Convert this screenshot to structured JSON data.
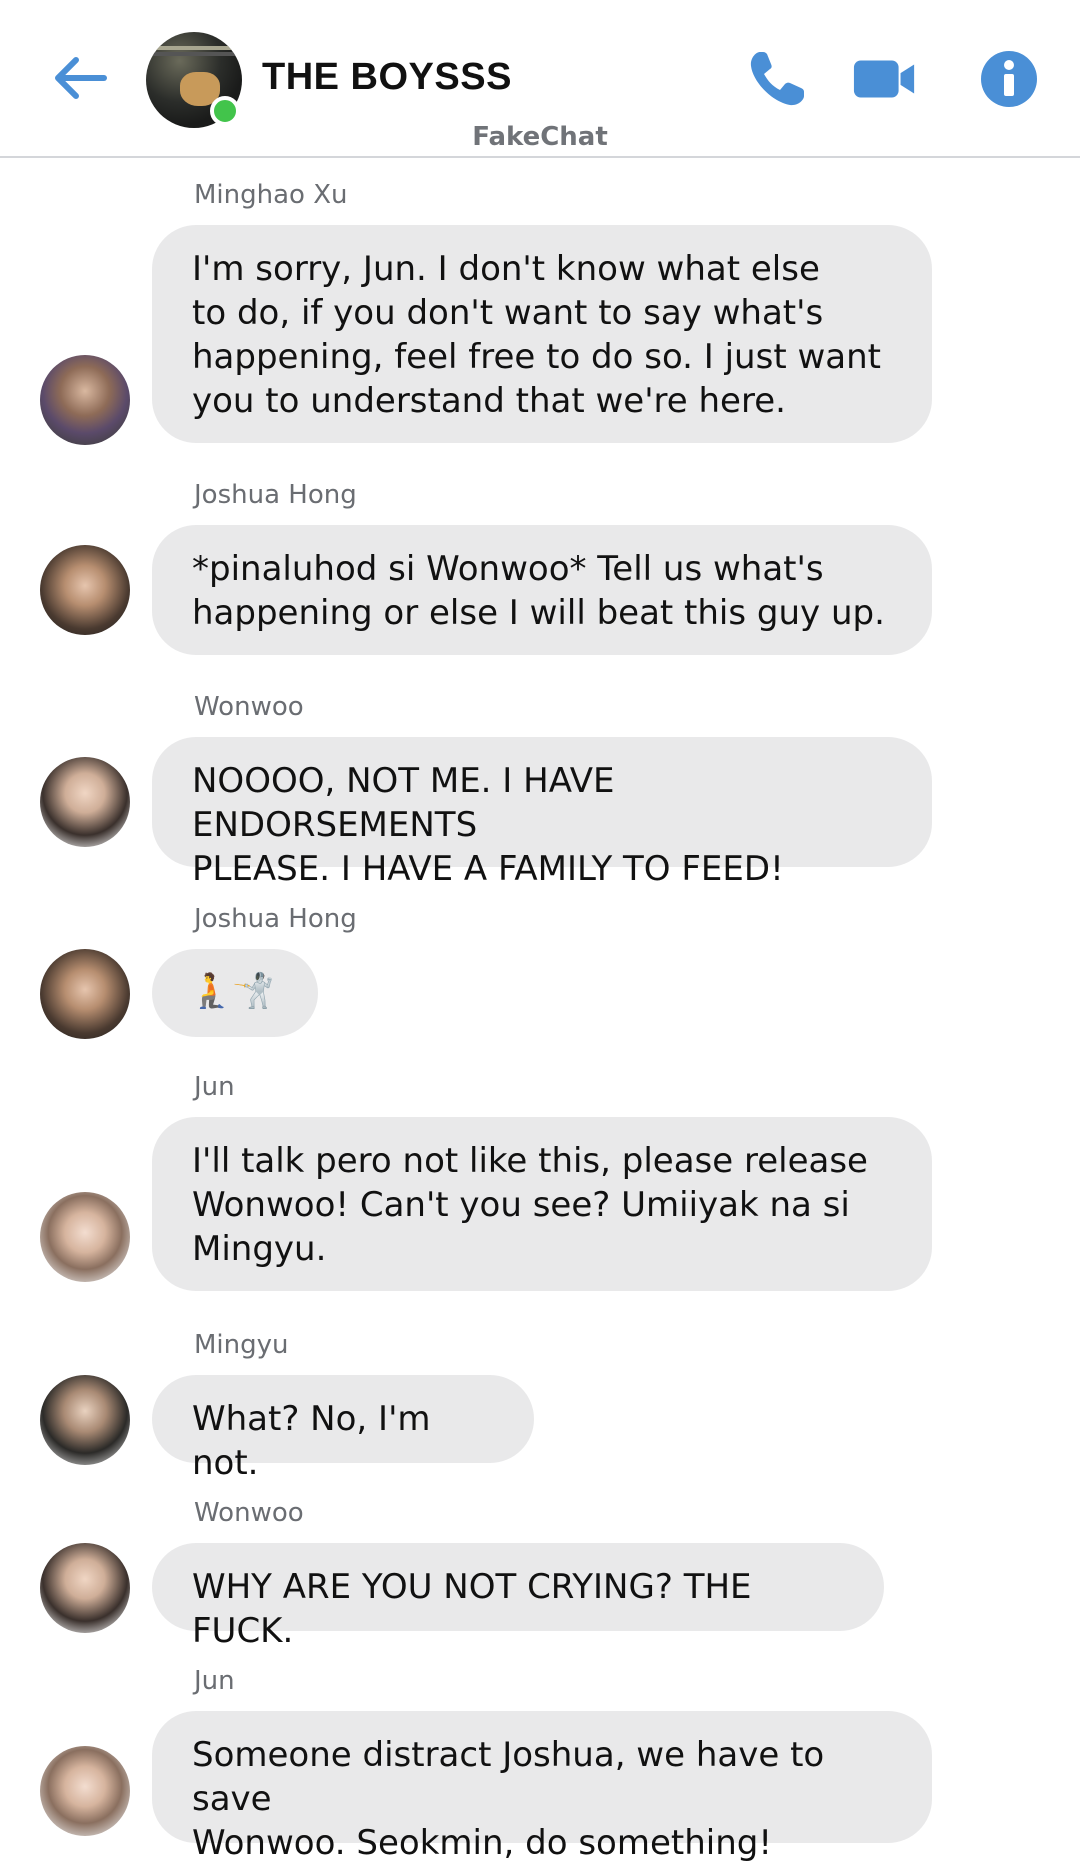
{
  "header": {
    "title": "THE BOYSSS",
    "subtitle": "FakeChat",
    "colors": {
      "accent": "#4a8fd6",
      "online": "#42c44b",
      "bubble": "#e9e9ea"
    },
    "icons": [
      "back-arrow-icon",
      "phone-icon",
      "video-camera-icon",
      "info-icon"
    ]
  },
  "messages": [
    {
      "sender": "Minghao Xu",
      "text": "I'm sorry, Jun. I don't know what else\nto do, if you don't want to say what's\nhappening, feel free to do so. I just want\nyou to understand that we're here."
    },
    {
      "sender": "Joshua Hong",
      "text": "*pinaluhod si Wonwoo* Tell us what's\nhappening or else I will beat this guy up."
    },
    {
      "sender": "Wonwoo",
      "text": "NOOOO, NOT ME. I HAVE ENDORSEMENTS\nPLEASE. I HAVE A FAMILY TO FEED!"
    },
    {
      "sender": "Joshua Hong",
      "text": "🧎🤺"
    },
    {
      "sender": "Jun",
      "text": "I'll talk pero not like this, please release\nWonwoo! Can't you see? Umiiyak na si\nMingyu."
    },
    {
      "sender": "Mingyu",
      "text": "What? No, I'm not."
    },
    {
      "sender": "Wonwoo",
      "text": "WHY ARE YOU NOT CRYING? THE FUCK."
    },
    {
      "sender": "Jun",
      "text": "Someone distract Joshua, we have to save\nWonwoo. Seokmin, do something!"
    }
  ]
}
